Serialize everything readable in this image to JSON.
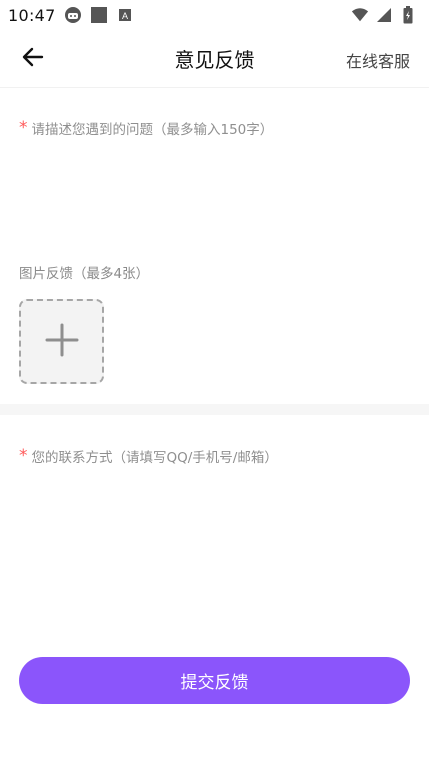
{
  "status_bar": {
    "time": "10:47",
    "left_icons": [
      "android-robot-icon",
      "square-notification-icon",
      "text-app-icon"
    ],
    "right_icons": [
      "wifi-icon",
      "cellular-signal-icon",
      "battery-icon"
    ]
  },
  "header": {
    "title": "意见反馈",
    "back_icon": "arrow-left-icon",
    "service_label": "在线客服"
  },
  "feedback": {
    "required_mark": "*",
    "description_placeholder": "请描述您遇到的问题（最多输入150字）",
    "description_value": "",
    "image_label": "图片反馈（最多4张）",
    "add_icon": "plus-icon"
  },
  "contact": {
    "required_mark": "*",
    "placeholder": "您的联系方式（请填写QQ/手机号/邮箱）",
    "value": ""
  },
  "submit_label": "提交反馈",
  "colors": {
    "accent": "#8b55fb",
    "required": "#ff5a5a",
    "placeholder": "#8f8f8f"
  }
}
